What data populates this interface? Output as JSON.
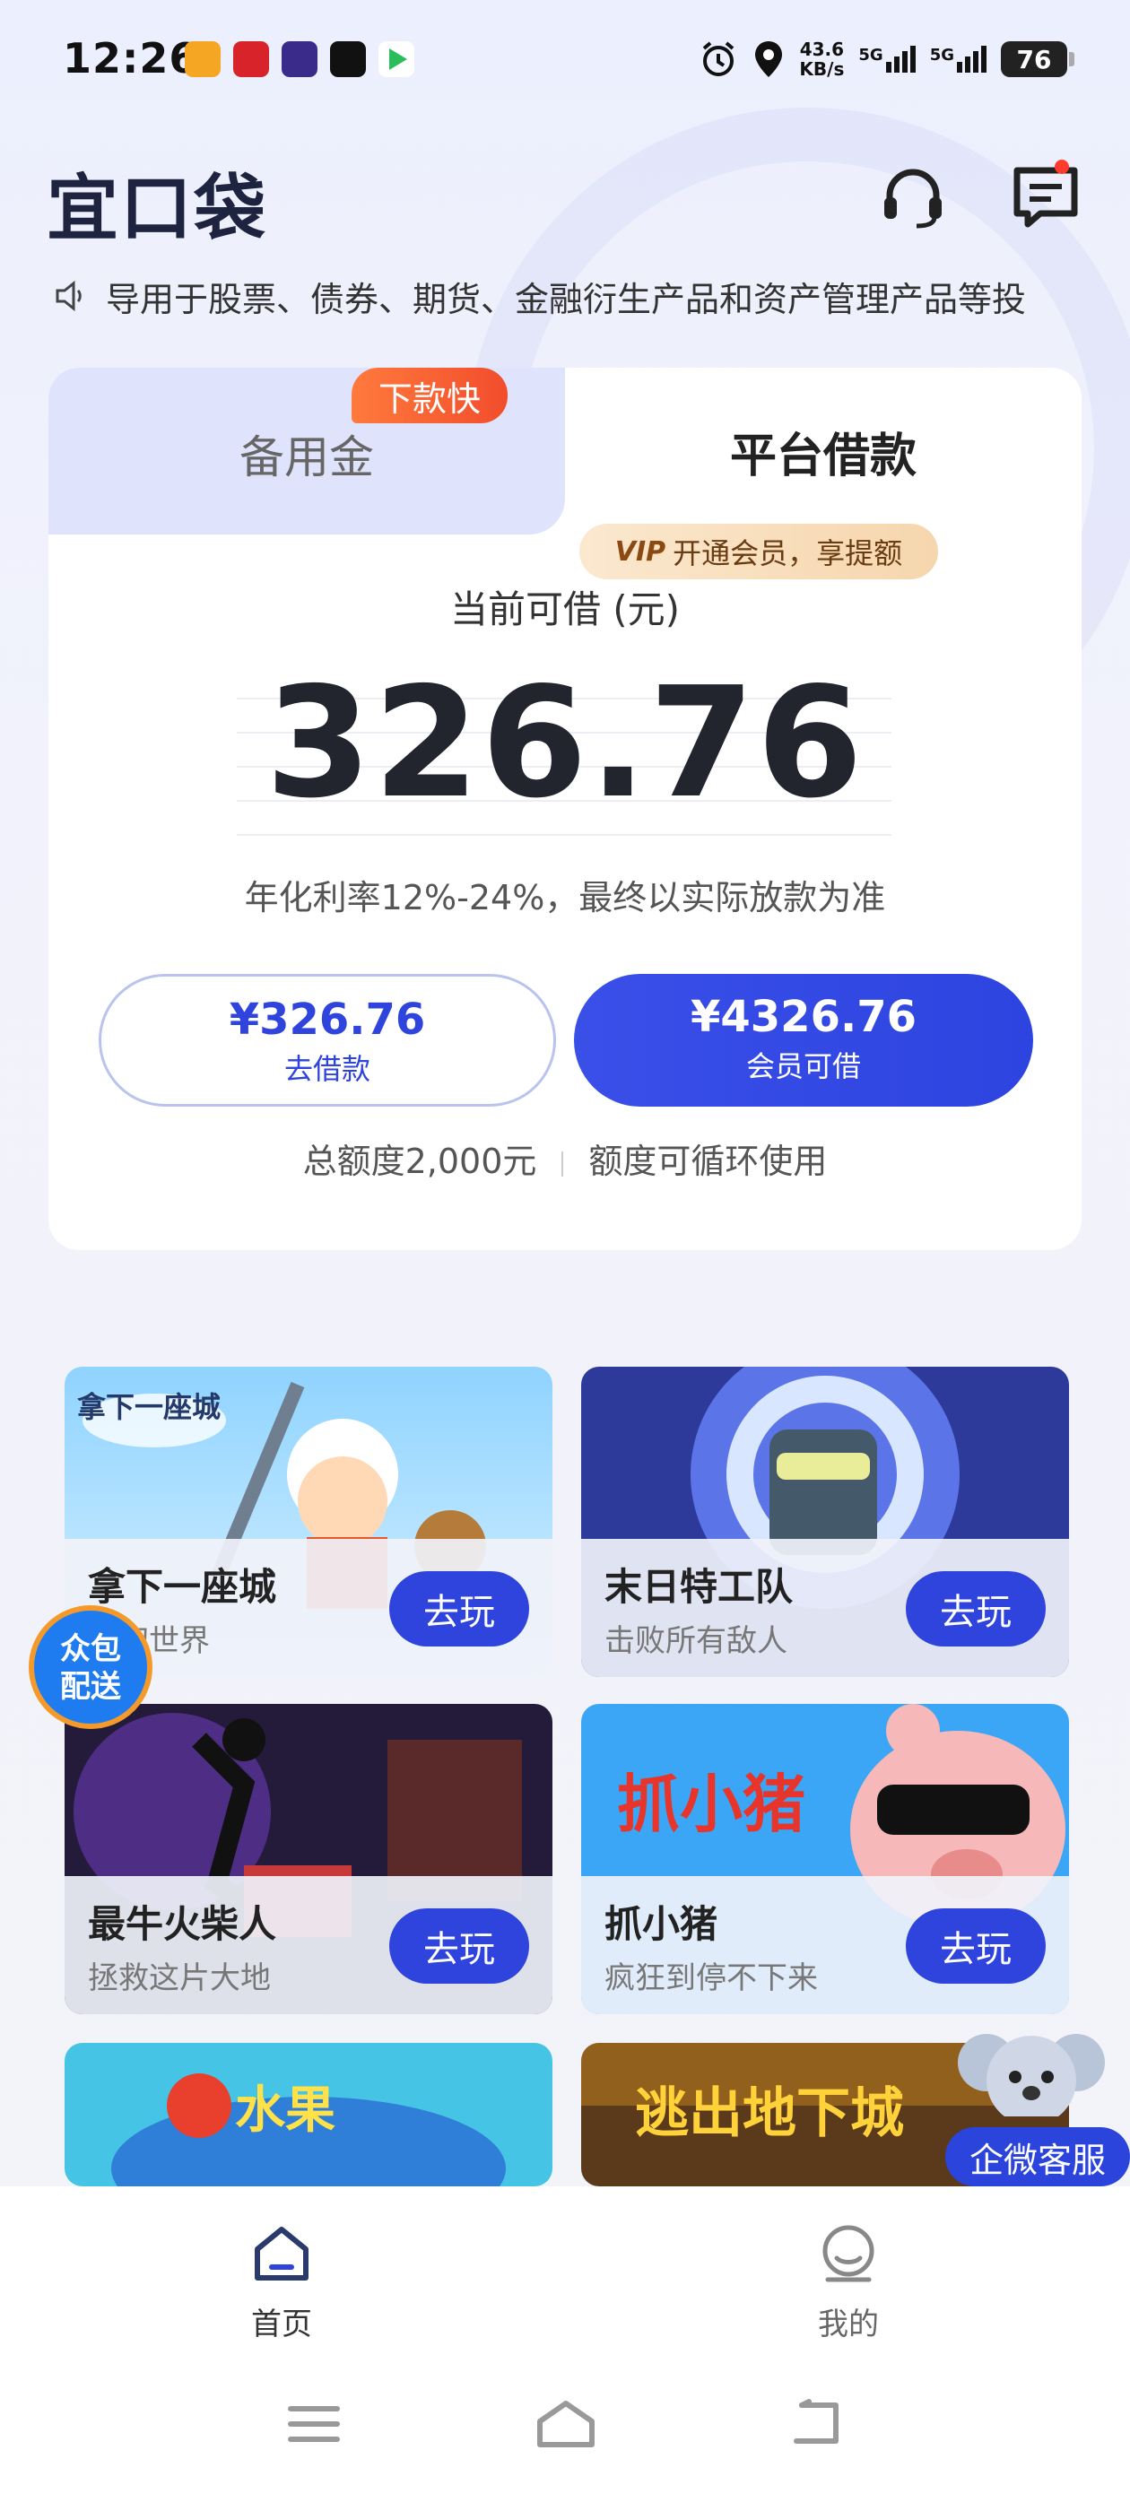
{
  "status_bar": {
    "time": "12:26",
    "speed_value": "43.6",
    "speed_unit": "KB/s",
    "signal1": "5G",
    "signal2": "5G",
    "battery": "76"
  },
  "header": {
    "logo": "宜口袋",
    "icons": [
      "headset-icon",
      "message-icon"
    ]
  },
  "notice": {
    "text": "导用于股票、债券、期货、金融衍生产品和资产管理产品等投"
  },
  "loan_card": {
    "tabs": [
      {
        "label": "备用金",
        "active": false
      },
      {
        "label": "平台借款",
        "active": true
      }
    ],
    "fast_tag": "下款快",
    "available_label": "当前可借 (元)",
    "amount": "326.76",
    "rate_text": "年化利率12%-24%，最终以实际放款为准",
    "borrow_button": {
      "amount": "¥326.76",
      "label": "去借款"
    },
    "member_button": {
      "amount": "¥4326.76",
      "label": "会员可借"
    },
    "vip_tag": {
      "vip": "VIP",
      "text": "开通会员，享提额"
    },
    "quota_total": "总额度2,000元",
    "quota_note": "额度可循环使用",
    "accent": "#2f44dc"
  },
  "games": [
    {
      "title": "拿下一座城",
      "desc": "奇幻世界",
      "button": "去玩",
      "art_text": "拿下一座城"
    },
    {
      "title": "末日特工队",
      "desc": "击败所有敌人",
      "button": "去玩"
    },
    {
      "title": "最牛火柴人",
      "desc": "拯救这片大地",
      "button": "去玩"
    },
    {
      "title": "抓小猪",
      "desc": "疯狂到停不下来",
      "button": "去玩",
      "art_text": "抓小猪"
    },
    {
      "art_text": "水果"
    },
    {
      "art_text": "逃出地下城"
    }
  ],
  "floating": {
    "crowd_badge": "众包\n配送",
    "crowd_line1": "众包",
    "crowd_line2": "配送",
    "customer_service": "企微客服"
  },
  "bottom_nav": [
    {
      "label": "首页",
      "icon": "home-icon",
      "active": true
    },
    {
      "label": "我的",
      "icon": "profile-icon",
      "active": false
    }
  ],
  "system_nav": [
    "menu-icon",
    "home-icon",
    "back-icon"
  ]
}
